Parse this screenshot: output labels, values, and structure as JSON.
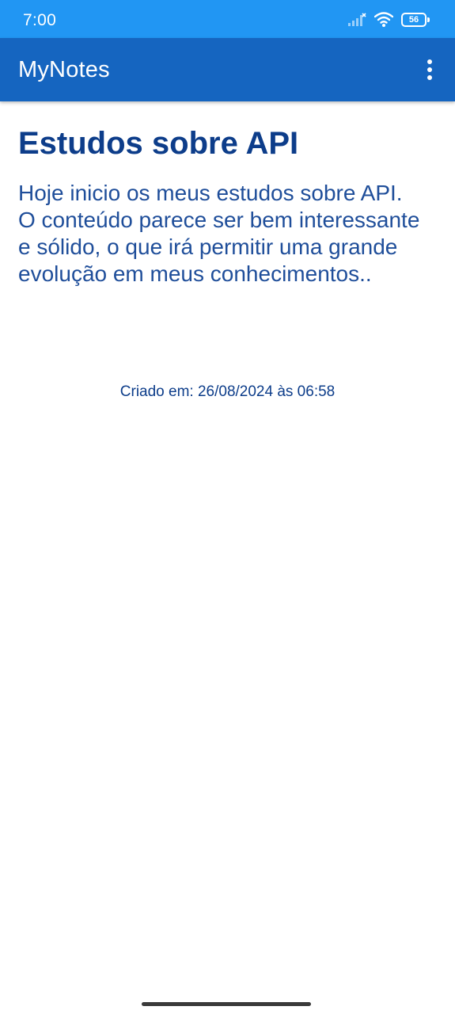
{
  "status_bar": {
    "time": "7:00",
    "battery_level": "56",
    "icons": [
      "signal-icon",
      "wifi-icon",
      "battery-icon"
    ],
    "color": "#2196f3"
  },
  "app_bar": {
    "title": "MyNotes",
    "menu_icon": "more-vert-icon",
    "color": "#1565c0"
  },
  "note": {
    "title": "Estudos sobre API",
    "body": "Hoje inicio os meus estudos sobre API.\nO conteúdo parece ser bem interessante e sólido, o que irá permitir uma grande evolução em meus conhecimentos..",
    "created_at": "Criado em: 26/08/2024 às 06:58",
    "text_color": "#0d3d8a"
  }
}
